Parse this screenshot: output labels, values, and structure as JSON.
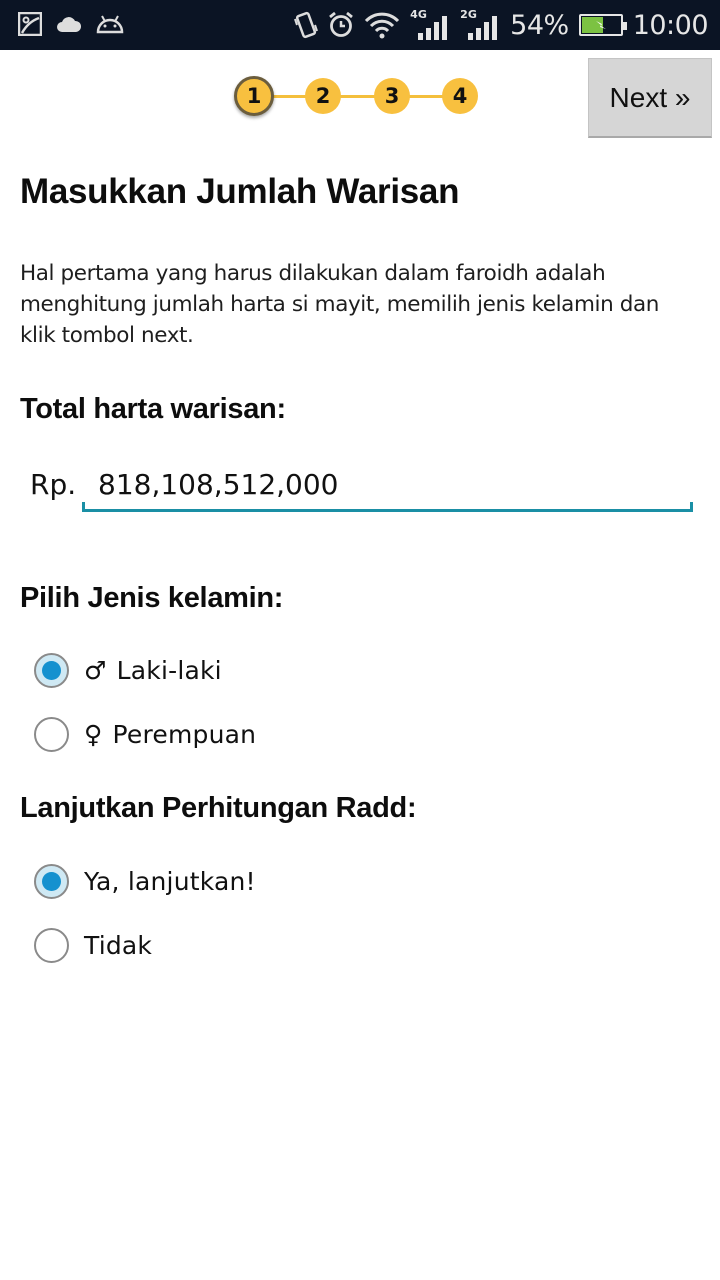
{
  "status_bar": {
    "left_icons": [
      "gallery-icon",
      "cloud-icon",
      "android-icon"
    ],
    "right_icons": [
      "vibrate-icon",
      "alarm-icon",
      "wifi-icon"
    ],
    "network_1": "4G",
    "network_2": "2G",
    "battery_percent": "54%",
    "battery_level": 0.54,
    "battery_charging": true,
    "time": "10:00"
  },
  "stepper": {
    "steps": [
      "1",
      "2",
      "3",
      "4"
    ],
    "active_step": 1,
    "color": "#f8c03f"
  },
  "next_button": {
    "label": "Next »"
  },
  "page": {
    "title": "Masukkan Jumlah Warisan",
    "description": "Hal pertama yang harus dilakukan dalam faroidh adalah menghitung jumlah harta si mayit, memilih jenis kelamin dan klik tombol next."
  },
  "total_harta": {
    "label": "Total harta warisan:",
    "currency_prefix": "Rp.",
    "value": "818,108,512,000",
    "accent_color": "#1a8fa5"
  },
  "gender": {
    "label": "Pilih Jenis kelamin:",
    "options": [
      {
        "symbol": "♂",
        "label": "Laki-laki",
        "checked": true
      },
      {
        "symbol": "♀",
        "label": "Perempuan",
        "checked": false
      }
    ]
  },
  "radd": {
    "label": "Lanjutkan Perhitungan Radd:",
    "options": [
      {
        "label": "Ya, lanjutkan!",
        "checked": true
      },
      {
        "label": "Tidak",
        "checked": false
      }
    ]
  },
  "colors": {
    "radio_checked": "#1591cf",
    "status_bar_bg": "#0b1424"
  }
}
